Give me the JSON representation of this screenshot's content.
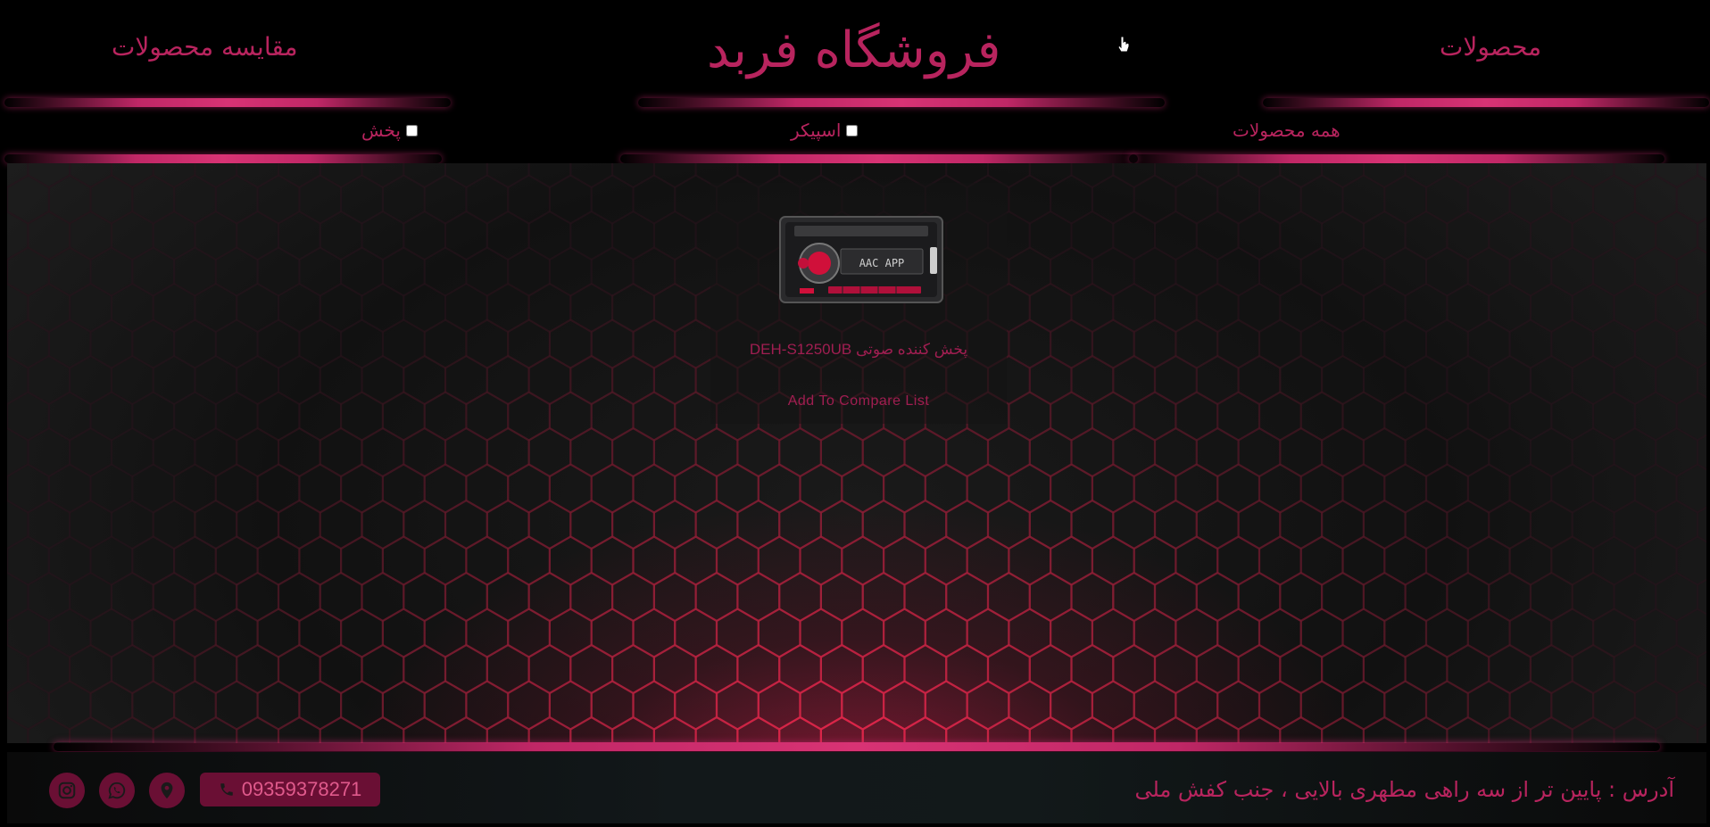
{
  "header": {
    "title": "فروشگاه فربد",
    "nav_compare": "مقایسه محصولات",
    "nav_products": "محصولات"
  },
  "filters": {
    "pakhsh_label": "پخش",
    "speaker_label": "اسپیکر",
    "all_label": "همه محصولات"
  },
  "product": {
    "name": "پخش کننده صوتی DEH-S1250UB",
    "compare_label": "Add To Compare List",
    "display_text": "AAC APP"
  },
  "footer": {
    "address": "آدرس : پایین تر از سه راهی مطهری بالایی ، جنب کفش ملی",
    "phone": "09359378271"
  },
  "colors": {
    "accent": "#b8245e",
    "button_bg": "#6a0f34",
    "glow": "#d83374"
  },
  "icons": [
    "phone-icon",
    "location-icon",
    "whatsapp-icon",
    "instagram-icon"
  ]
}
